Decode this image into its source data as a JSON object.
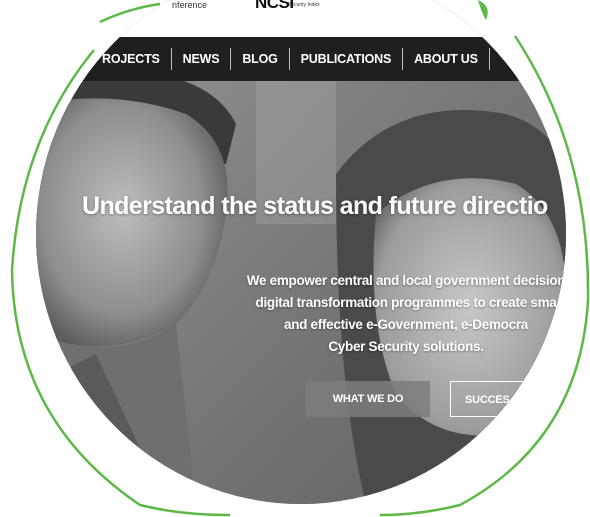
{
  "brand": {
    "conference_fragment": "nference",
    "ncsi_fragment": "NCSI",
    "ncsi_subtitle": "Security Index"
  },
  "nav": {
    "items": [
      {
        "label": "ROJECTS"
      },
      {
        "label": "NEWS"
      },
      {
        "label": "BLOG"
      },
      {
        "label": "PUBLICATIONS"
      },
      {
        "label": "ABOUT US"
      }
    ]
  },
  "hero": {
    "headline": "Understand the status and future directio",
    "intro_lines": [
      "We empower central and local government decision",
      "digital transformation programmes to create sma",
      "and effective e-Government, e-Democra",
      "Cyber Security solutions."
    ],
    "primary_button": "WHAT WE DO",
    "secondary_button": "SUCCES"
  },
  "colors": {
    "accent_green": "#5db848",
    "nav_background": "#1f1f1f",
    "button_gray": "#7d7d7d"
  }
}
